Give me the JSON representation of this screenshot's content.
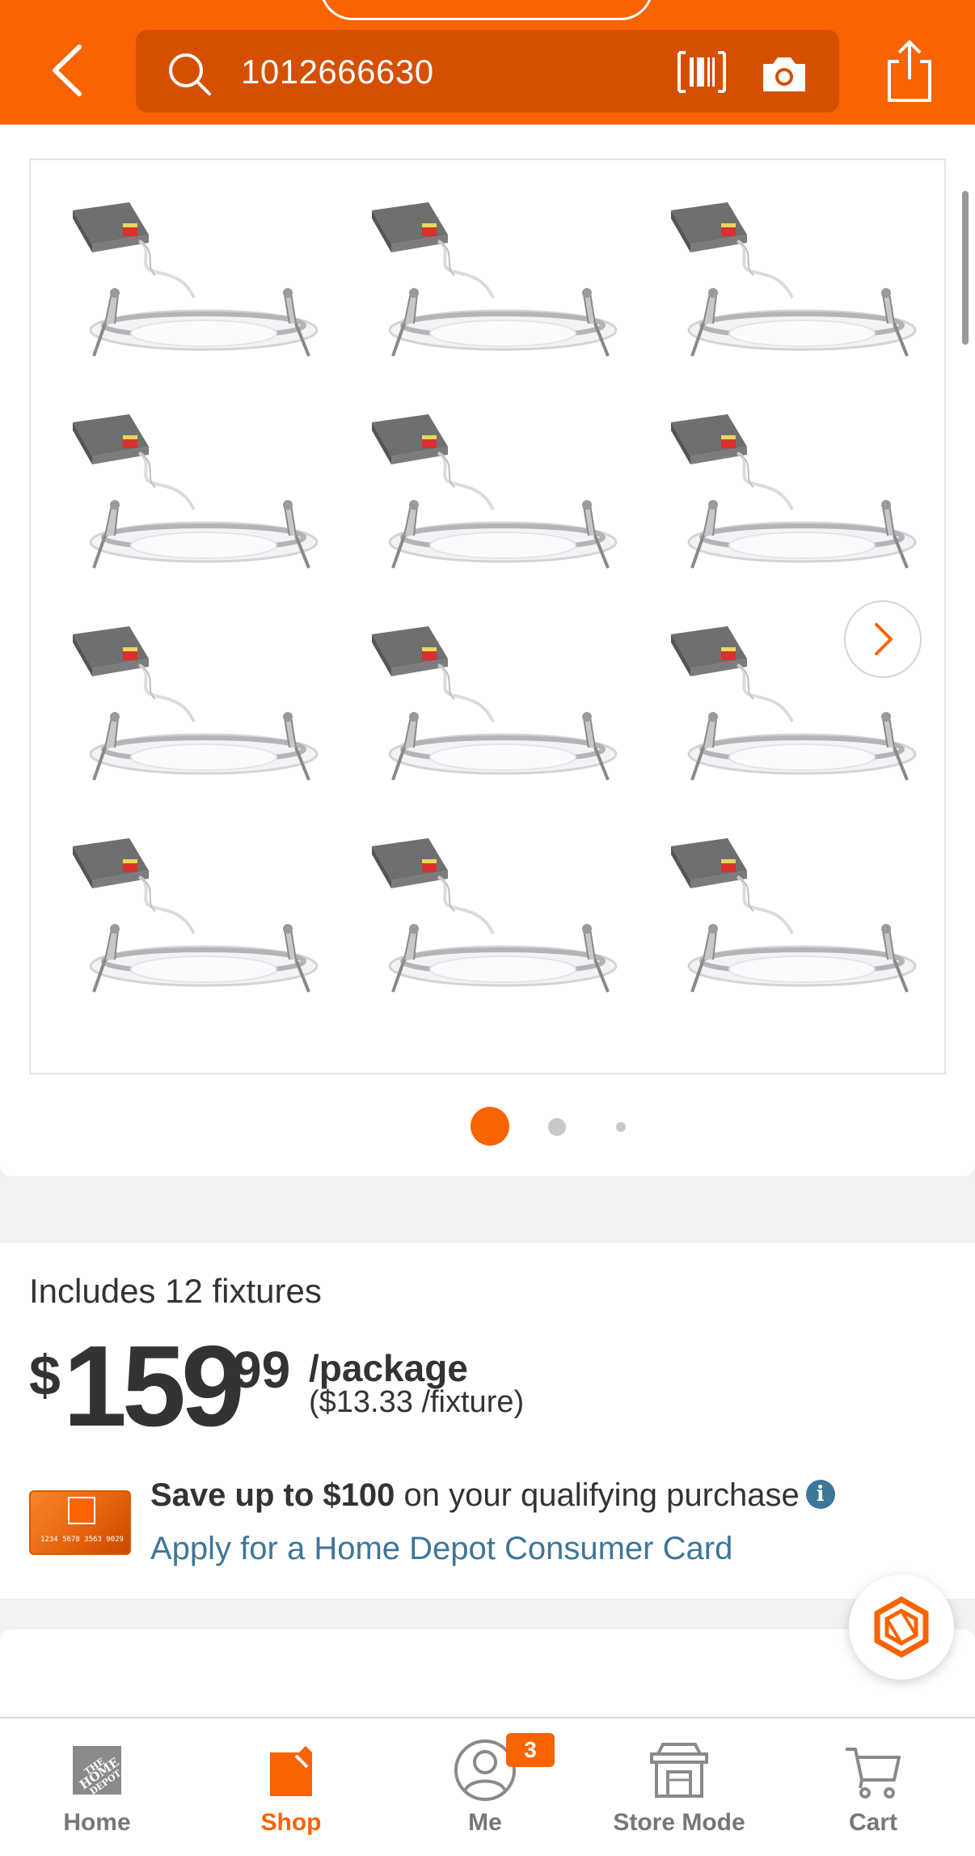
{
  "header": {
    "search_value": "1012666630",
    "icons": [
      "back-arrow-icon",
      "search-icon",
      "barcode-icon",
      "camera-icon",
      "share-icon"
    ]
  },
  "gallery": {
    "fixture_count_shown": 12,
    "dots_count": 3,
    "active_dot": 1
  },
  "pricing": {
    "includes": "Includes 12 fixtures",
    "currency": "$",
    "dollars": "159",
    "cents": "99",
    "unit": "/package",
    "per_unit": "($13.33 /fixture)"
  },
  "promo": {
    "save_bold": "Save up to $100",
    "save_rest": " on your qualifying purchase",
    "info_glyph": "i",
    "apply_link": "Apply for a Home Depot Consumer Card",
    "card_number": "1234 5678 3563 9029"
  },
  "bottom_nav": {
    "items": [
      {
        "label": "Home",
        "icon": "home-depot-logo-icon"
      },
      {
        "label": "Shop",
        "icon": "shop-icon"
      },
      {
        "label": "Me",
        "icon": "profile-icon",
        "badge": "3"
      },
      {
        "label": "Store Mode",
        "icon": "store-icon"
      },
      {
        "label": "Cart",
        "icon": "cart-icon"
      }
    ]
  },
  "colors": {
    "brand_orange": "#f96302",
    "search_bg": "#d54f00",
    "link_blue": "#3e7697"
  }
}
